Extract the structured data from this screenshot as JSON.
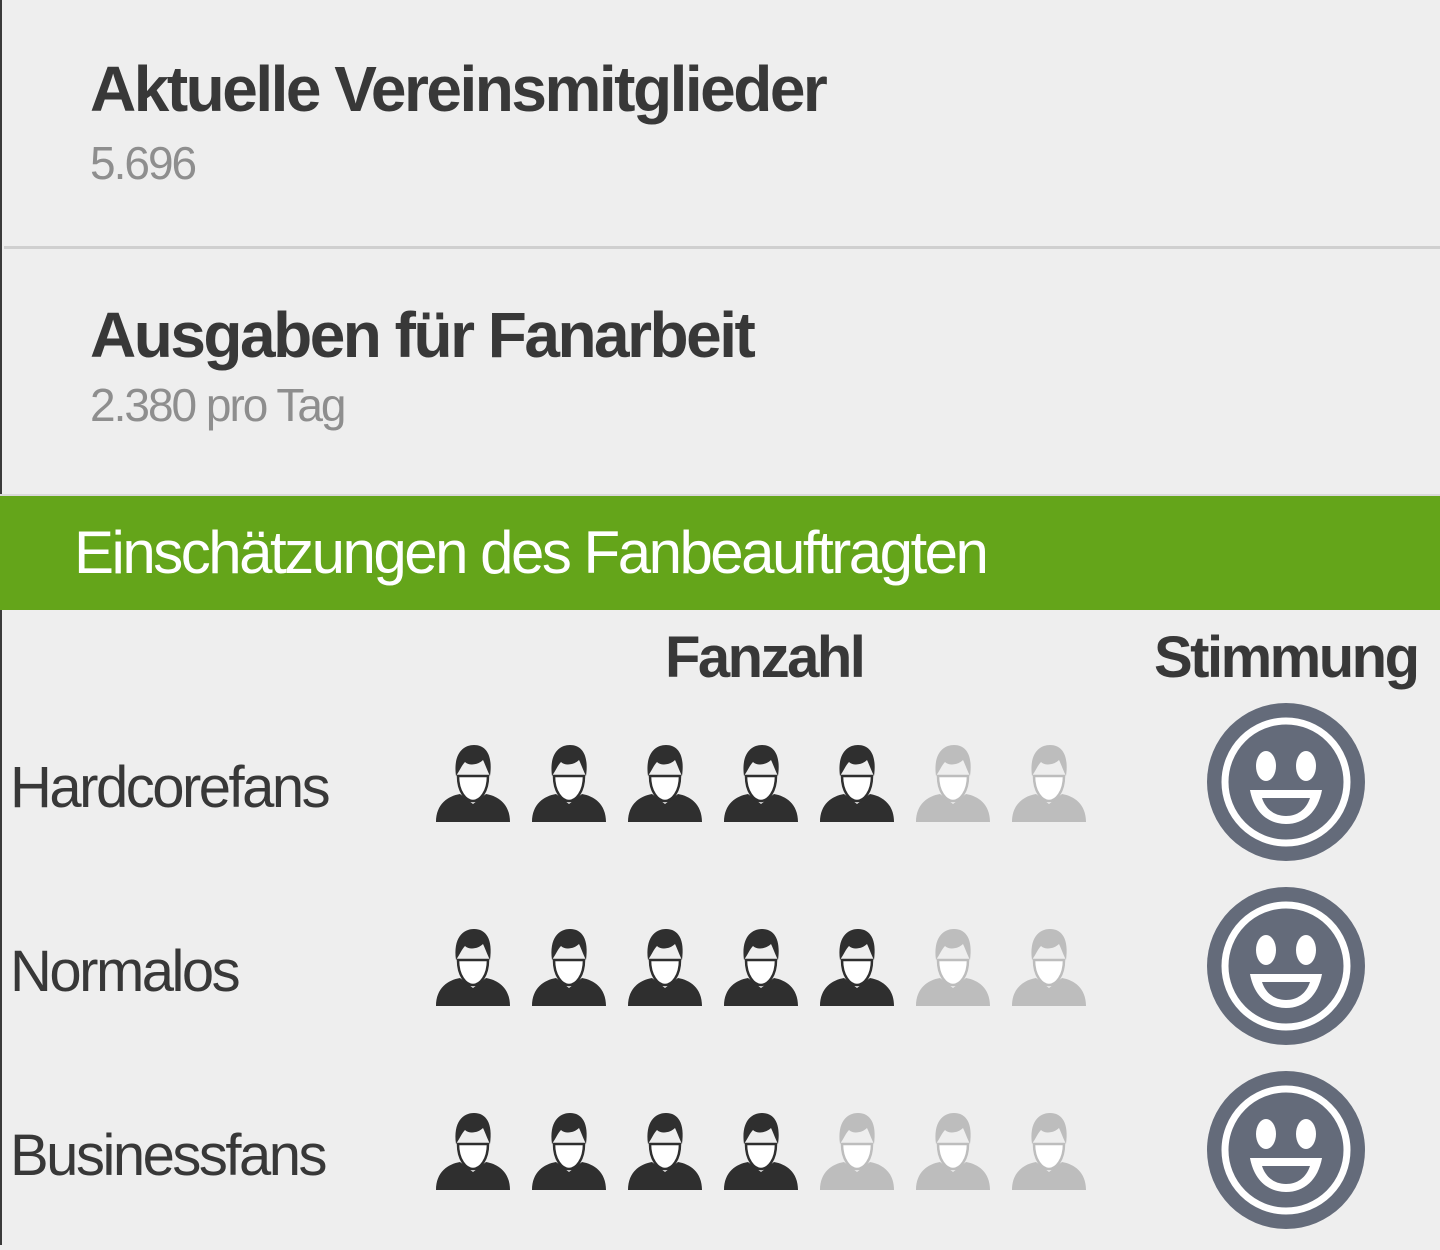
{
  "stats": [
    {
      "title": "Aktuelle Vereinsmitglieder",
      "value": "5.696"
    },
    {
      "title": "Ausgaben für Fanarbeit",
      "value": "2.380 pro Tag"
    }
  ],
  "section": {
    "title": "Einschätzungen des Fanbeauftragten",
    "col_fanzahl": "Fanzahl",
    "col_stimmung": "Stimmung"
  },
  "rows": [
    {
      "label": "Hardcorefans",
      "fans_filled": 5,
      "fans_total": 7,
      "mood": "laughing-smiley-icon"
    },
    {
      "label": "Normalos",
      "fans_filled": 5,
      "fans_total": 7,
      "mood": "laughing-smiley-icon"
    },
    {
      "label": "Businessfans",
      "fans_filled": 4,
      "fans_total": 7,
      "mood": "laughing-smiley-icon"
    }
  ],
  "colors": {
    "banner": "#64a51a",
    "fan_filled": "#2f2f2f",
    "fan_empty": "#bdbdbd",
    "mood": "#646b7a"
  }
}
